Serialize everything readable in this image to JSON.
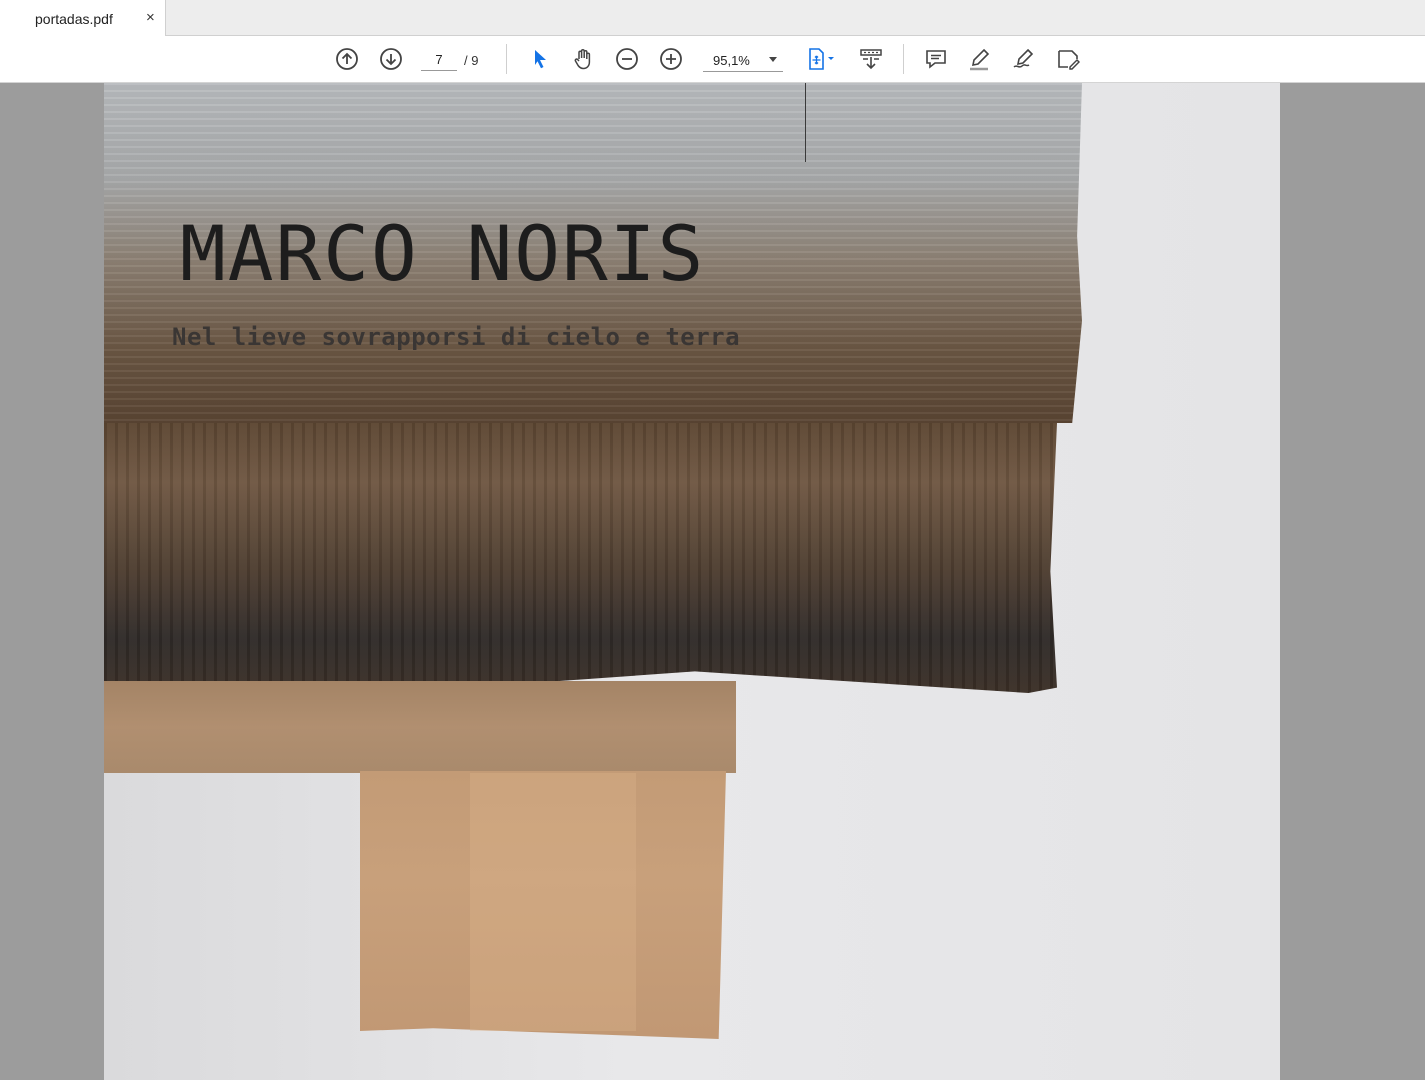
{
  "tab": {
    "title": "portadas.pdf",
    "close": "×"
  },
  "toolbar": {
    "page_current": "7",
    "page_total": "/ 9",
    "zoom": "95,1%",
    "accent_color": "#1473e6"
  },
  "document": {
    "title": "MARCO NORIS",
    "subtitle": "Nel lieve sovrapporsi di cielo e terra"
  }
}
